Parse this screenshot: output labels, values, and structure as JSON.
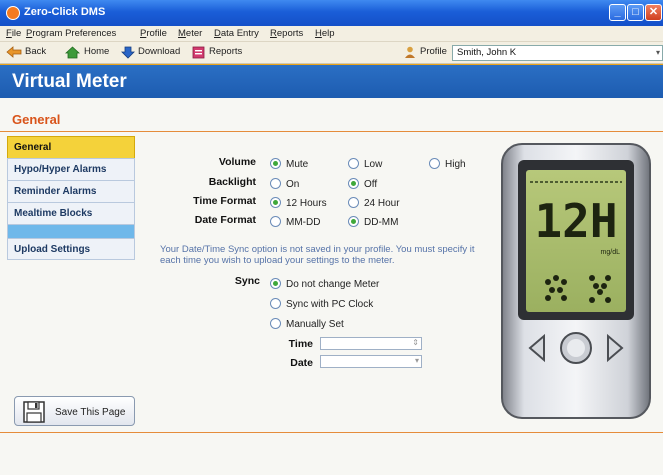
{
  "window": {
    "title": "Zero-Click DMS",
    "buttons": {
      "minimize": "_",
      "maximize": "□",
      "close": "✕"
    }
  },
  "menu": [
    "File",
    "Program Preferences",
    "Profile",
    "Meter",
    "Data Entry",
    "Reports",
    "Help"
  ],
  "toolbar": {
    "back": "Back",
    "home": "Home",
    "download": "Download",
    "reports": "Reports",
    "profile_label": "Profile",
    "profile_value": "Smith, John K"
  },
  "header": {
    "title": "Virtual Meter"
  },
  "section": {
    "title": "General"
  },
  "sidenav": [
    "General",
    "Hypo/Hyper Alarms",
    "Reminder Alarms",
    "Mealtime Blocks",
    "Upload Settings"
  ],
  "settings": {
    "volume": {
      "label": "Volume",
      "options": [
        "Mute",
        "Low",
        "High"
      ],
      "selected": "Mute"
    },
    "backlight": {
      "label": "Backlight",
      "options": [
        "On",
        "Off"
      ],
      "selected": "Off"
    },
    "time_format": {
      "label": "Time Format",
      "options": [
        "12 Hours",
        "24 Hour"
      ],
      "selected": "12 Hours"
    },
    "date_format": {
      "label": "Date Format",
      "options": [
        "MM-DD",
        "DD-MM"
      ],
      "selected": "DD-MM"
    }
  },
  "note": "Your Date/Time Sync option is not saved in your profile. You must specify it each time you wish to upload your settings to the meter.",
  "sync": {
    "label": "Sync",
    "options": [
      "Do not change Meter",
      "Sync with PC Clock",
      "Manually Set"
    ],
    "selected": "Do not change Meter",
    "time_label": "Time",
    "date_label": "Date"
  },
  "meter": {
    "display": "12H",
    "unit": "mg/dL"
  },
  "save_button": "Save This Page",
  "colors": {
    "accent": "#d9541a",
    "header": "#1d5cb0",
    "nav_active": "#f4d23a",
    "frame": "#e9a318"
  }
}
